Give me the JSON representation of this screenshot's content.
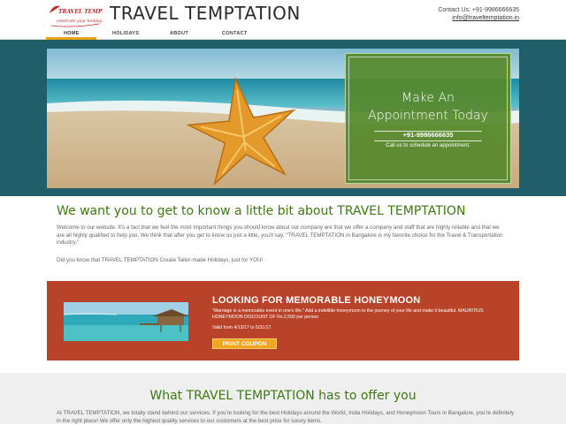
{
  "header": {
    "brand": "TRAVEL TEMPTATION",
    "logo_text": "TRAVEL TEMPTATION",
    "logo_tagline": "celebrate your holidays...",
    "contact_line": "Contact Us: +91-9986666635",
    "email": "info@traveltemptation.in"
  },
  "nav": {
    "items": [
      {
        "label": "HOME"
      },
      {
        "label": "HOLIDAYS"
      },
      {
        "label": "ABOUT"
      },
      {
        "label": "CONTACT"
      }
    ],
    "active": "HOME"
  },
  "hero": {
    "appointment_title_1": "Make An",
    "appointment_title_2": "Appointment Today",
    "phone": "+91-9986666635",
    "subtitle": "Call us to schedule an appointment."
  },
  "about": {
    "title": "We want you to get to know a little bit about TRAVEL TEMPTATION",
    "paragraph": "Welcome to our website. It's a fact that we feel the most important things you should know about our company are that we offer a company and staff that are highly reliable and that we are all highly qualified to help you. We think that after you get to know us just a little, you'll say, \"TRAVEL TEMPTATION in Bangalore is my favorite choice for the Travel & Transportation industry.\"",
    "paragraph2": "Did you know that TRAVEL TEMPTATION Create Tailor-made Holidays, just for YOU!"
  },
  "promo": {
    "title": "LOOKING FOR MEMORABLE HONEYMOON",
    "description": "\"Marriage is a memorable event in one's life.\" Add a indelible honeymoon to the journey of your life and make it beautiful. MAURITIUS HONEYMOON DISCOUNT OF Rs.2,500 per person",
    "valid": "Valid from 4/13/17 to 5/31/17.",
    "button": "PRINT COUPON"
  },
  "offer": {
    "title": "What TRAVEL TEMPTATION has to offer you",
    "paragraph": "At TRAVEL TEMPTATION, we totally stand behind our services. If you're looking for the best Holidays around the World, India Holidays, and Honeymoon Tours in Bangalore, you're definitely in the right place! We offer only the highest quality services to our customers at the best price for luxury items."
  },
  "colors": {
    "accent_green": "#3d7a12",
    "hero_band": "#205f6a",
    "appointment_box": "#56892c",
    "promo_bg": "#b84329",
    "button": "#f0a620",
    "nav_active": "#e8a317"
  }
}
